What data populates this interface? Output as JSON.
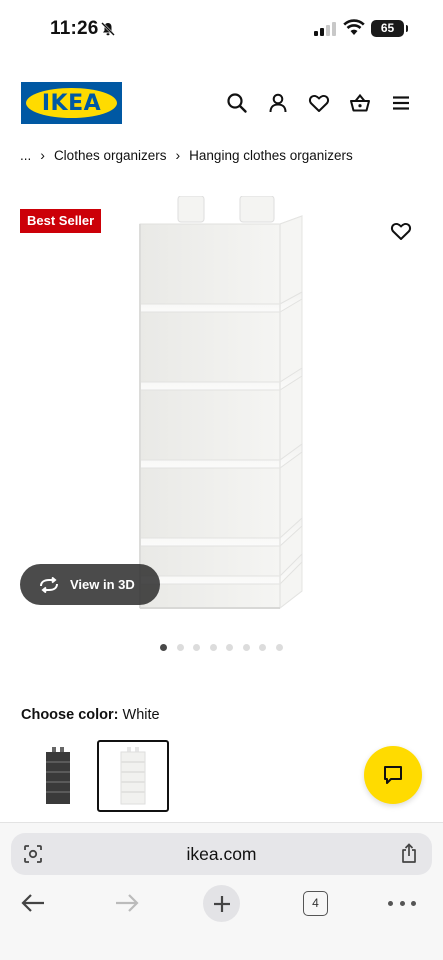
{
  "status_bar": {
    "time": "11:26",
    "battery": "65"
  },
  "header": {
    "logo_text": "IKEA",
    "icons": [
      "search-icon",
      "account-icon",
      "favorites-icon",
      "basket-icon",
      "menu-icon"
    ]
  },
  "breadcrumb": {
    "ellipsis": "...",
    "items": [
      "Clothes organizers",
      "Hanging clothes organizers"
    ]
  },
  "product": {
    "badge": "Best Seller",
    "view_3d": "View in 3D",
    "image_count": 8,
    "active_image": 1
  },
  "color_choice": {
    "label": "Choose color:",
    "value": "White",
    "swatches": [
      "Dark gray",
      "White"
    ],
    "selected": "White"
  },
  "colors": {
    "ikea_blue": "#0058a3",
    "ikea_yellow": "#ffdb00",
    "badge_red": "#cc0008"
  },
  "browser": {
    "url": "ikea.com",
    "tab_count": "4"
  }
}
